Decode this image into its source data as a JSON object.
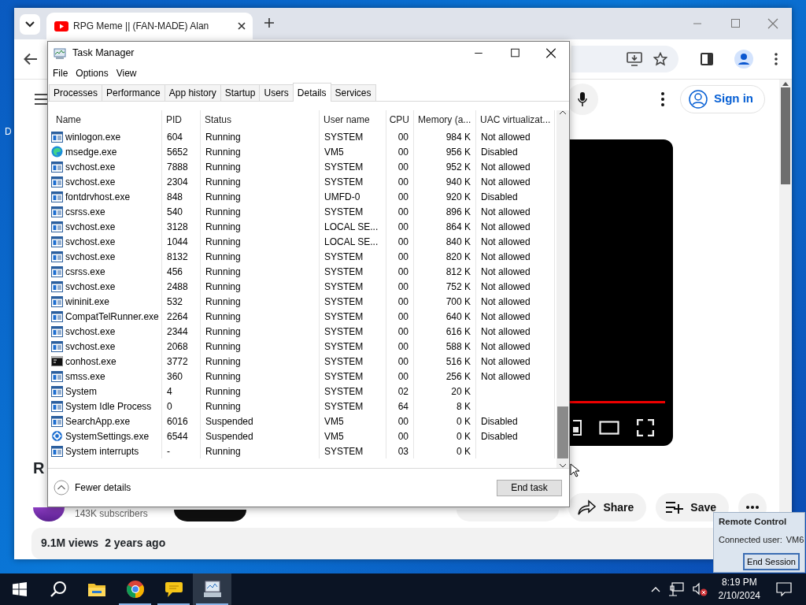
{
  "desktop": {
    "icon_label": "D"
  },
  "browser": {
    "tab": {
      "title": "RPG Meme || (FAN-MADE) Alan",
      "selected": true
    },
    "youtube": {
      "sign_in": "Sign in",
      "video_title": "R",
      "subscribers": "143K subscribers",
      "actions": [
        {
          "kind": "share",
          "label": "Share"
        },
        {
          "kind": "save",
          "label": "Save"
        }
      ],
      "views": "9.1M views",
      "age": "2 years ago"
    }
  },
  "task_manager": {
    "title": "Task Manager",
    "menu": [
      "File",
      "Options",
      "View"
    ],
    "tabs": [
      {
        "label": "Processes",
        "selected": false
      },
      {
        "label": "Performance",
        "selected": false
      },
      {
        "label": "App history",
        "selected": false
      },
      {
        "label": "Startup",
        "selected": false
      },
      {
        "label": "Users",
        "selected": false
      },
      {
        "label": "Details",
        "selected": true
      },
      {
        "label": "Services",
        "selected": false
      }
    ],
    "columns": [
      "Name",
      "PID",
      "Status",
      "User name",
      "CPU",
      "Memory (a...",
      "UAC virtualizat..."
    ],
    "rows": [
      {
        "kind": "app",
        "name": "winlogon.exe",
        "pid": "604",
        "status": "Running",
        "user": "SYSTEM",
        "cpu": "00",
        "memory": "984 K",
        "uac": "Not allowed"
      },
      {
        "kind": "edge",
        "name": "msedge.exe",
        "pid": "5652",
        "status": "Running",
        "user": "VM5",
        "cpu": "00",
        "memory": "956 K",
        "uac": "Disabled"
      },
      {
        "kind": "app",
        "name": "svchost.exe",
        "pid": "7888",
        "status": "Running",
        "user": "SYSTEM",
        "cpu": "00",
        "memory": "952 K",
        "uac": "Not allowed"
      },
      {
        "kind": "app",
        "name": "svchost.exe",
        "pid": "2304",
        "status": "Running",
        "user": "SYSTEM",
        "cpu": "00",
        "memory": "940 K",
        "uac": "Not allowed"
      },
      {
        "kind": "app",
        "name": "fontdrvhost.exe",
        "pid": "848",
        "status": "Running",
        "user": "UMFD-0",
        "cpu": "00",
        "memory": "920 K",
        "uac": "Disabled"
      },
      {
        "kind": "app",
        "name": "csrss.exe",
        "pid": "540",
        "status": "Running",
        "user": "SYSTEM",
        "cpu": "00",
        "memory": "896 K",
        "uac": "Not allowed"
      },
      {
        "kind": "app",
        "name": "svchost.exe",
        "pid": "3128",
        "status": "Running",
        "user": "LOCAL SE...",
        "cpu": "00",
        "memory": "864 K",
        "uac": "Not allowed"
      },
      {
        "kind": "app",
        "name": "svchost.exe",
        "pid": "1044",
        "status": "Running",
        "user": "LOCAL SE...",
        "cpu": "00",
        "memory": "840 K",
        "uac": "Not allowed"
      },
      {
        "kind": "app",
        "name": "svchost.exe",
        "pid": "8132",
        "status": "Running",
        "user": "SYSTEM",
        "cpu": "00",
        "memory": "820 K",
        "uac": "Not allowed"
      },
      {
        "kind": "app",
        "name": "csrss.exe",
        "pid": "456",
        "status": "Running",
        "user": "SYSTEM",
        "cpu": "00",
        "memory": "812 K",
        "uac": "Not allowed"
      },
      {
        "kind": "app",
        "name": "svchost.exe",
        "pid": "2488",
        "status": "Running",
        "user": "SYSTEM",
        "cpu": "00",
        "memory": "752 K",
        "uac": "Not allowed"
      },
      {
        "kind": "app",
        "name": "wininit.exe",
        "pid": "532",
        "status": "Running",
        "user": "SYSTEM",
        "cpu": "00",
        "memory": "700 K",
        "uac": "Not allowed"
      },
      {
        "kind": "app",
        "name": "CompatTelRunner.exe",
        "pid": "2264",
        "status": "Running",
        "user": "SYSTEM",
        "cpu": "00",
        "memory": "640 K",
        "uac": "Not allowed"
      },
      {
        "kind": "app",
        "name": "svchost.exe",
        "pid": "2344",
        "status": "Running",
        "user": "SYSTEM",
        "cpu": "00",
        "memory": "616 K",
        "uac": "Not allowed"
      },
      {
        "kind": "app",
        "name": "svchost.exe",
        "pid": "2068",
        "status": "Running",
        "user": "SYSTEM",
        "cpu": "00",
        "memory": "588 K",
        "uac": "Not allowed"
      },
      {
        "kind": "console",
        "name": "conhost.exe",
        "pid": "3772",
        "status": "Running",
        "user": "SYSTEM",
        "cpu": "00",
        "memory": "516 K",
        "uac": "Not allowed"
      },
      {
        "kind": "app",
        "name": "smss.exe",
        "pid": "360",
        "status": "Running",
        "user": "SYSTEM",
        "cpu": "00",
        "memory": "256 K",
        "uac": "Not allowed"
      },
      {
        "kind": "app",
        "name": "System",
        "pid": "4",
        "status": "Running",
        "user": "SYSTEM",
        "cpu": "02",
        "memory": "20 K"
      },
      {
        "kind": "app",
        "name": "System Idle Process",
        "pid": "0",
        "status": "Running",
        "user": "SYSTEM",
        "cpu": "64",
        "memory": "8 K"
      },
      {
        "kind": "app",
        "name": "SearchApp.exe",
        "pid": "6016",
        "status": "Suspended",
        "user": "VM5",
        "cpu": "00",
        "memory": "0 K",
        "uac": "Disabled"
      },
      {
        "kind": "gear",
        "name": "SystemSettings.exe",
        "pid": "6544",
        "status": "Suspended",
        "user": "VM5",
        "cpu": "00",
        "memory": "0 K",
        "uac": "Disabled"
      },
      {
        "kind": "app",
        "name": "System interrupts",
        "pid": "-",
        "status": "Running",
        "user": "SYSTEM",
        "cpu": "03",
        "memory": "0 K"
      }
    ],
    "fewer_details": "Fewer details",
    "end_task": "End task"
  },
  "remote_control": {
    "title": "Remote Control",
    "connected_label": "Connected user:",
    "connected_user": "VM6",
    "button": "End Session"
  },
  "taskbar": {
    "apps": [
      {
        "kind": "explorer",
        "running": false,
        "selected": false
      },
      {
        "kind": "chrome",
        "running": true,
        "selected": false
      },
      {
        "kind": "chat",
        "running": true,
        "selected": false
      },
      {
        "kind": "taskmgr",
        "running": true,
        "selected": true
      }
    ],
    "time": "8:19 PM",
    "date": "2/10/2024"
  }
}
